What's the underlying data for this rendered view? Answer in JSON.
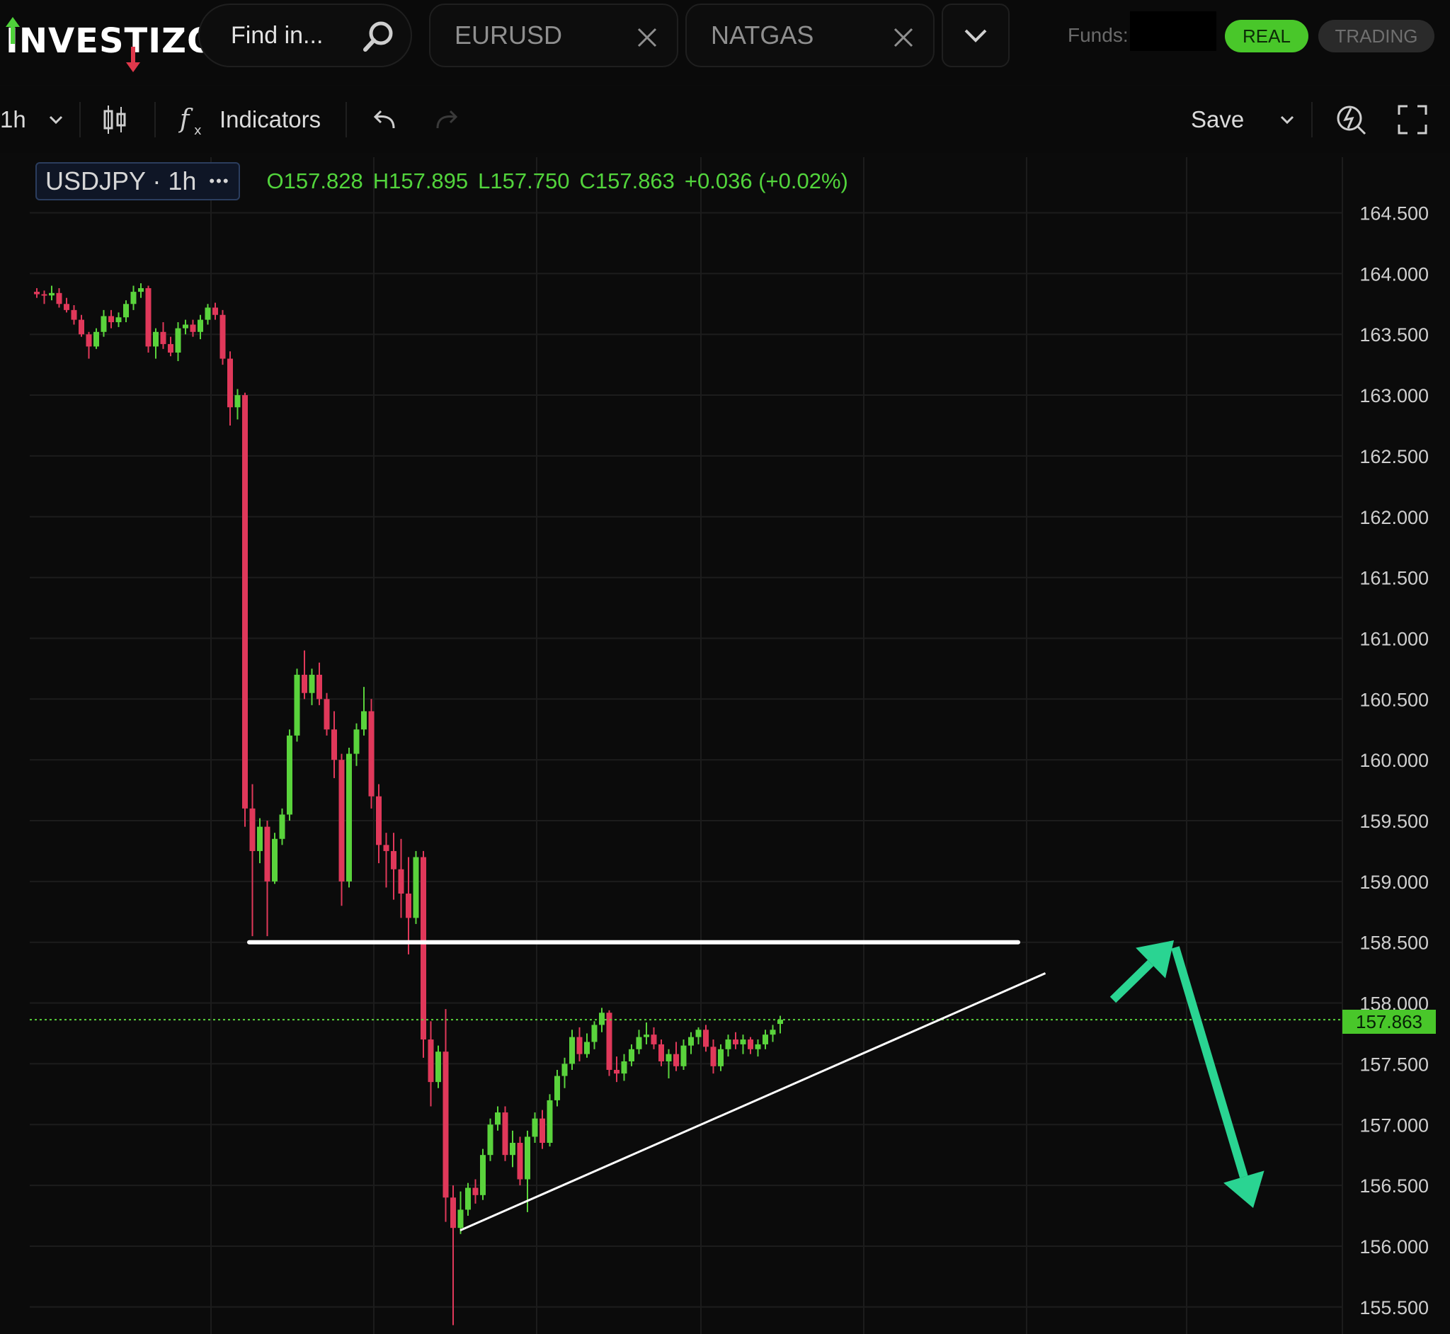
{
  "app": {
    "logo_text": "INVESTIZO",
    "search_placeholder": "Find in...",
    "tabs": [
      {
        "label": "EURUSD"
      },
      {
        "label": "NATGAS"
      }
    ],
    "funds_label": "Funds:",
    "real_label": "REAL",
    "trading_label": "TRADING"
  },
  "toolbar": {
    "interval": "1h",
    "indicators_label": "Indicators",
    "save_label": "Save"
  },
  "legend": {
    "symbol": "USDJPY · 1h",
    "more": "•••",
    "open": "O157.828",
    "high": "H157.895",
    "low": "L157.750",
    "close": "C157.863",
    "change": "+0.036 (+0.02%)"
  },
  "colors": {
    "up": "#5ad33c",
    "down": "#e0385a",
    "accent": "#2ad492",
    "brand_green": "#49c72a"
  },
  "chart_data": {
    "type": "candlestick",
    "symbol": "USDJPY",
    "interval": "1h",
    "ylim": [
      155.3,
      164.9
    ],
    "y_ticks": [
      "164.500",
      "164.000",
      "163.500",
      "163.000",
      "162.500",
      "162.000",
      "161.500",
      "161.000",
      "160.500",
      "160.000",
      "159.500",
      "159.000",
      "158.500",
      "158.000",
      "157.500",
      "157.000",
      "156.500",
      "156.000",
      "155.500"
    ],
    "last_price": "157.863",
    "horizontal_line": 158.5,
    "candles": [
      [
        163.85,
        163.88,
        163.8,
        163.83
      ],
      [
        163.83,
        163.86,
        163.75,
        163.82
      ],
      [
        163.82,
        163.9,
        163.78,
        163.84
      ],
      [
        163.84,
        163.88,
        163.72,
        163.75
      ],
      [
        163.75,
        163.8,
        163.68,
        163.7
      ],
      [
        163.7,
        163.74,
        163.58,
        163.62
      ],
      [
        163.62,
        163.66,
        163.48,
        163.5
      ],
      [
        163.5,
        163.52,
        163.3,
        163.4
      ],
      [
        163.4,
        163.55,
        163.38,
        163.52
      ],
      [
        163.52,
        163.7,
        163.48,
        163.65
      ],
      [
        163.65,
        163.7,
        163.55,
        163.6
      ],
      [
        163.6,
        163.68,
        163.56,
        163.64
      ],
      [
        163.64,
        163.78,
        163.6,
        163.75
      ],
      [
        163.75,
        163.9,
        163.7,
        163.85
      ],
      [
        163.85,
        163.92,
        163.8,
        163.88
      ],
      [
        163.88,
        163.9,
        163.35,
        163.4
      ],
      [
        163.4,
        163.55,
        163.3,
        163.52
      ],
      [
        163.52,
        163.6,
        163.38,
        163.42
      ],
      [
        163.42,
        163.48,
        163.32,
        163.35
      ],
      [
        163.35,
        163.6,
        163.28,
        163.55
      ],
      [
        163.55,
        163.62,
        163.5,
        163.58
      ],
      [
        163.58,
        163.62,
        163.48,
        163.52
      ],
      [
        163.52,
        163.66,
        163.46,
        163.62
      ],
      [
        163.62,
        163.75,
        163.58,
        163.72
      ],
      [
        163.72,
        163.76,
        163.62,
        163.66
      ],
      [
        163.66,
        163.7,
        163.25,
        163.3
      ],
      [
        163.3,
        163.36,
        162.75,
        162.9
      ],
      [
        162.9,
        163.05,
        162.8,
        163.0
      ],
      [
        163.0,
        163.02,
        159.45,
        159.6
      ],
      [
        159.6,
        159.8,
        158.55,
        159.25
      ],
      [
        159.25,
        159.52,
        159.15,
        159.45
      ],
      [
        159.45,
        159.5,
        158.55,
        159.0
      ],
      [
        159.0,
        159.4,
        158.98,
        159.35
      ],
      [
        159.35,
        159.6,
        159.3,
        159.55
      ],
      [
        159.55,
        160.25,
        159.5,
        160.2
      ],
      [
        160.2,
        160.75,
        160.15,
        160.7
      ],
      [
        160.7,
        160.9,
        160.5,
        160.55
      ],
      [
        160.55,
        160.75,
        160.45,
        160.7
      ],
      [
        160.7,
        160.8,
        160.45,
        160.5
      ],
      [
        160.5,
        160.55,
        160.2,
        160.25
      ],
      [
        160.25,
        160.4,
        159.85,
        160.0
      ],
      [
        160.0,
        160.05,
        158.8,
        159.0
      ],
      [
        159.0,
        160.1,
        158.95,
        160.05
      ],
      [
        160.05,
        160.3,
        159.95,
        160.25
      ],
      [
        160.25,
        160.6,
        160.2,
        160.4
      ],
      [
        160.4,
        160.5,
        159.6,
        159.7
      ],
      [
        159.7,
        159.8,
        159.15,
        159.3
      ],
      [
        159.3,
        159.4,
        158.95,
        159.25
      ],
      [
        159.25,
        159.4,
        158.85,
        159.1
      ],
      [
        159.1,
        159.35,
        158.7,
        158.9
      ],
      [
        158.9,
        159.2,
        158.4,
        158.7
      ],
      [
        158.7,
        159.25,
        158.65,
        159.2
      ],
      [
        159.2,
        159.25,
        157.55,
        157.7
      ],
      [
        157.7,
        157.85,
        157.15,
        157.35
      ],
      [
        157.35,
        157.65,
        157.3,
        157.6
      ],
      [
        157.6,
        157.95,
        156.2,
        156.4
      ],
      [
        156.4,
        156.5,
        155.35,
        156.15
      ],
      [
        156.15,
        156.45,
        156.1,
        156.3
      ],
      [
        156.3,
        156.52,
        156.25,
        156.48
      ],
      [
        156.48,
        156.55,
        156.35,
        156.42
      ],
      [
        156.42,
        156.8,
        156.38,
        156.75
      ],
      [
        156.75,
        157.05,
        156.7,
        157.0
      ],
      [
        157.0,
        157.15,
        156.95,
        157.1
      ],
      [
        157.1,
        157.15,
        156.7,
        156.75
      ],
      [
        156.75,
        156.95,
        156.65,
        156.85
      ],
      [
        156.85,
        156.9,
        156.5,
        156.55
      ],
      [
        156.55,
        156.95,
        156.28,
        156.9
      ],
      [
        156.9,
        157.1,
        156.85,
        157.05
      ],
      [
        157.05,
        157.12,
        156.8,
        156.85
      ],
      [
        156.85,
        157.25,
        156.82,
        157.2
      ],
      [
        157.2,
        157.45,
        157.15,
        157.4
      ],
      [
        157.4,
        157.55,
        157.3,
        157.5
      ],
      [
        157.5,
        157.78,
        157.45,
        157.72
      ],
      [
        157.72,
        157.8,
        157.52,
        157.58
      ],
      [
        157.58,
        157.75,
        157.55,
        157.68
      ],
      [
        157.68,
        157.85,
        157.62,
        157.82
      ],
      [
        157.82,
        157.96,
        157.76,
        157.92
      ],
      [
        157.92,
        157.94,
        157.4,
        157.45
      ],
      [
        157.45,
        157.56,
        157.35,
        157.42
      ],
      [
        157.42,
        157.58,
        157.36,
        157.52
      ],
      [
        157.52,
        157.66,
        157.48,
        157.62
      ],
      [
        157.62,
        157.78,
        157.58,
        157.72
      ],
      [
        157.72,
        157.84,
        157.66,
        157.74
      ],
      [
        157.74,
        157.8,
        157.62,
        157.66
      ],
      [
        157.66,
        157.7,
        157.48,
        157.52
      ],
      [
        157.52,
        157.62,
        157.38,
        157.58
      ],
      [
        157.58,
        157.68,
        157.44,
        157.48
      ],
      [
        157.48,
        157.7,
        157.45,
        157.65
      ],
      [
        157.65,
        157.76,
        157.58,
        157.72
      ],
      [
        157.72,
        157.8,
        157.66,
        157.78
      ],
      [
        157.78,
        157.82,
        157.6,
        157.64
      ],
      [
        157.64,
        157.7,
        157.42,
        157.48
      ],
      [
        157.48,
        157.66,
        157.44,
        157.62
      ],
      [
        157.62,
        157.74,
        157.56,
        157.7
      ],
      [
        157.7,
        157.76,
        157.62,
        157.66
      ],
      [
        157.66,
        157.74,
        157.58,
        157.7
      ],
      [
        157.7,
        157.72,
        157.58,
        157.62
      ],
      [
        157.62,
        157.7,
        157.56,
        157.66
      ],
      [
        157.66,
        157.78,
        157.62,
        157.74
      ],
      [
        157.74,
        157.82,
        157.68,
        157.78
      ],
      [
        157.828,
        157.895,
        157.75,
        157.863
      ]
    ],
    "trend_line": [
      [
        56,
        156.13
      ],
      [
        109,
        158.07
      ]
    ],
    "arrows": [
      {
        "from": [
          102,
          157.98
        ],
        "to": [
          106,
          158.5
        ]
      },
      {
        "from": [
          106,
          158.5
        ],
        "to": [
          112,
          156.28
        ]
      }
    ]
  }
}
